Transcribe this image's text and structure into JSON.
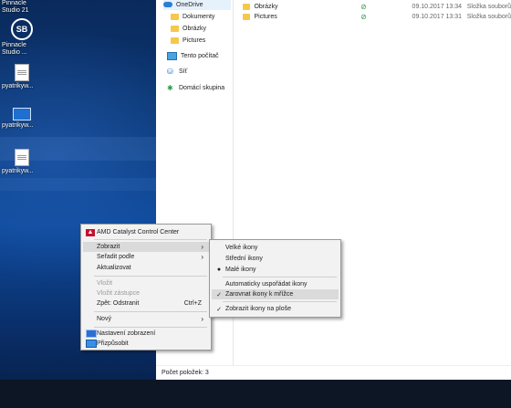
{
  "desktop": {
    "icons": [
      {
        "label_lines": [
          "Pinnacle",
          "Studio 21"
        ]
      },
      {
        "label_lines": [
          "Pinnacle",
          "Studio ..."
        ]
      },
      {
        "label_lines": [
          "pyatrikyw..."
        ]
      },
      {
        "label_lines": [
          "pyatrikyw..."
        ]
      },
      {
        "label_lines": [
          "pyatrikyw..."
        ]
      }
    ]
  },
  "explorer": {
    "nav": [
      {
        "label": "OneDrive",
        "icon": "cloud-icon"
      },
      {
        "label": "Dokumenty",
        "icon": "folder-icon"
      },
      {
        "label": "Obrázky",
        "icon": "folder-icon"
      },
      {
        "label": "Pictures",
        "icon": "folder-icon"
      },
      {
        "label": "Tento počítač",
        "icon": "computer-icon"
      },
      {
        "label": "Síť",
        "icon": "network-icon"
      },
      {
        "label": "Domácí skupina",
        "icon": "homegroup-icon"
      }
    ],
    "files": [
      {
        "name": "Obrázky",
        "date": "09.10.2017 13:34",
        "type": "Složka souborů"
      },
      {
        "name": "Pictures",
        "date": "09.10.2017 13:31",
        "type": "Složka souborů"
      }
    ],
    "status": "Počet položek: 3"
  },
  "context_menu": {
    "amd": "AMD Catalyst Control Center",
    "zobrazit": "Zobrazit",
    "seradit": "Seřadit podle",
    "aktualizovat": "Aktualizovat",
    "vlozit": "Vložit",
    "vlozit_zastupce": "Vložit zástupce",
    "zpet": "Zpět: Odstranit",
    "zpet_shortcut": "Ctrl+Z",
    "novy": "Nový",
    "nastaveni": "Nastavení zobrazení",
    "prizpusobit": "Přizpůsobit"
  },
  "submenu": {
    "velke": "Velké ikony",
    "stredni": "Střední ikony",
    "male": "Malé ikony",
    "auto": "Automaticky uspořádat ikony",
    "zarovnat": "Zarovnat ikony k mřížce",
    "zobrazit_plose": "Zobrazit ikony na ploše"
  },
  "colors": {
    "accent": "#2b7cd3",
    "check": "#2e9a4a",
    "amd": "#c8102e"
  }
}
